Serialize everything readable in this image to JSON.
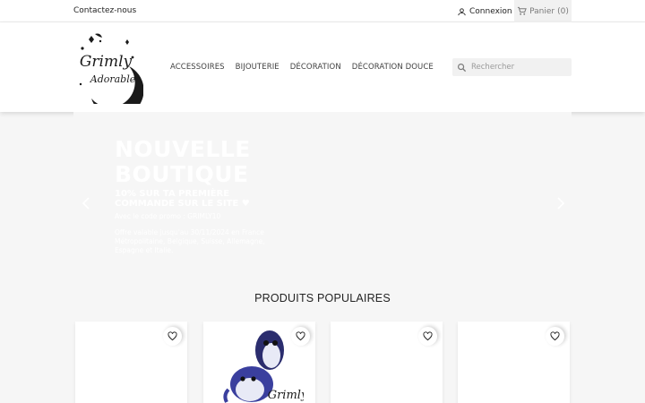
{
  "topbar": {
    "contact_label": "Contactez-nous",
    "login_label": "Connexion",
    "cart_label": "Panier",
    "cart_count": "(0)"
  },
  "header": {
    "logo_text_line1": "Grimly",
    "logo_text_line2": "Adorable",
    "nav": [
      {
        "label": "ACCESSOIRES"
      },
      {
        "label": "BIJOUTERIE"
      },
      {
        "label": "DÉCORATION"
      },
      {
        "label": "DÉCORATION DOUCE"
      }
    ],
    "search_placeholder": "Rechercher"
  },
  "carousel": {
    "title": "NOUVELLE BOUTIQUE",
    "subtitle": "10% SUR TA PREMIÈRE COMMANDE SUR LE SITE ♥",
    "code": "Avec le code promo : GRIMLY10",
    "description": "Offre valable jusqu'au 30/11/2024 en France Métropolitaine, Belgique, Suisse, Allemagne, Espagne et Italie."
  },
  "products": {
    "title": "PRODUITS POPULAIRES",
    "items": [
      {
        "has_image": false
      },
      {
        "has_image": true
      },
      {
        "has_image": false
      },
      {
        "has_image": false
      }
    ]
  },
  "colors": {
    "accent": "#24b9d7",
    "text": "#232323",
    "background": "#f6f6f6"
  }
}
